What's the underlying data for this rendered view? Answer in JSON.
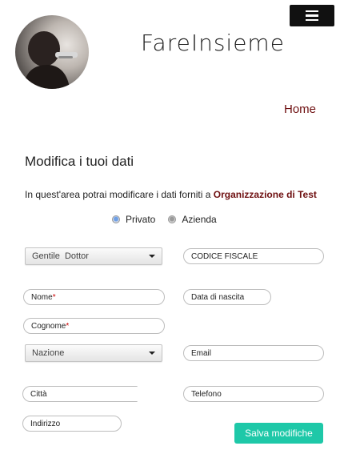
{
  "header": {
    "brand": "FareInsieme",
    "nav_home": "Home"
  },
  "page": {
    "title": "Modifica i tuoi dati",
    "intro_text": "In quest'area potrai modificare i dati forniti a ",
    "intro_org": "Organizzazione di Test"
  },
  "form": {
    "type_options": [
      {
        "label": "Privato",
        "selected": true
      },
      {
        "label": "Azienda",
        "selected": false
      }
    ],
    "title_select": "Gentile  Dottor",
    "codice_fiscale": "CODICE FISCALE",
    "nome": "Nome",
    "data_nascita": "Data di nascita",
    "cognome": "Cognome",
    "nazione_select": "Nazione",
    "email": "Email",
    "citta": "Città",
    "telefono": "Telefono",
    "indirizzo": "Indirizzo",
    "required_mark": "*",
    "save_label": "Salva modifiche"
  },
  "colors": {
    "accent_dark": "#6e0f10",
    "save_button": "#1ec8a8"
  }
}
